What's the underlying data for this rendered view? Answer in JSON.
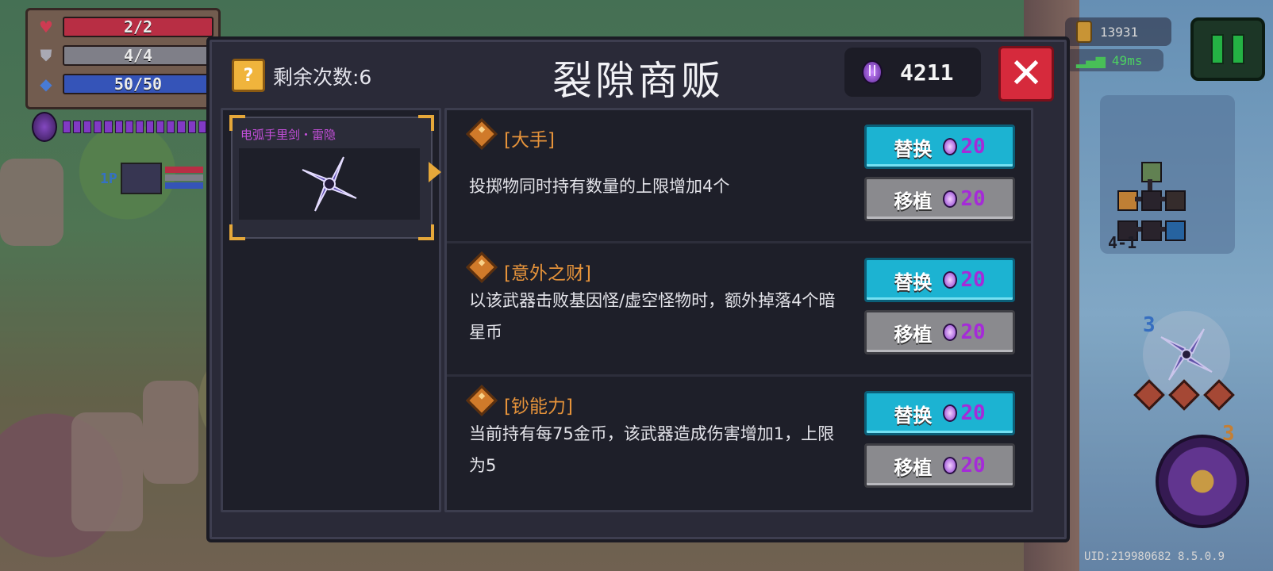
{
  "hud": {
    "hp": "2/2",
    "armor": "4/4",
    "energy": "50/50",
    "player_tag": "1P",
    "coins": "13931",
    "ping": "49ms",
    "level": "4-1",
    "weapon_count": "3",
    "skill_count": "3",
    "uid": "UID:219980682 8.5.0.9"
  },
  "shop": {
    "remaining_label": "剩余次数:6",
    "title": "裂隙商贩",
    "currency": "4211",
    "item_name": "电弧手里剑・雷隐",
    "traits": [
      {
        "name": "[大手]",
        "desc": "投掷物同时持有数量的上限增加4个",
        "replace_label": "替换",
        "replace_cost": "20",
        "transplant_label": "移植",
        "transplant_cost": "20"
      },
      {
        "name": "[意外之财]",
        "desc": "以该武器击败基因怪/虚空怪物时，额外掉落4个暗星币",
        "replace_label": "替换",
        "replace_cost": "20",
        "transplant_label": "移植",
        "transplant_cost": "20"
      },
      {
        "name": "[钞能力]",
        "desc": "当前持有每75金币，该武器造成伤害增加1，上限为5",
        "replace_label": "替换",
        "replace_cost": "20",
        "transplant_label": "移植",
        "transplant_cost": "20"
      }
    ]
  },
  "colors": {
    "hp_bar": "#c8324a",
    "armor_bar": "#8a8a94",
    "energy_bar": "#3a5cc8",
    "replace_btn": "#1cb3d2",
    "transplant_btn": "#8a8a8e",
    "trait_name": "#e6933a",
    "item_name": "#c34fd9",
    "close_btn": "#d62a3c"
  }
}
